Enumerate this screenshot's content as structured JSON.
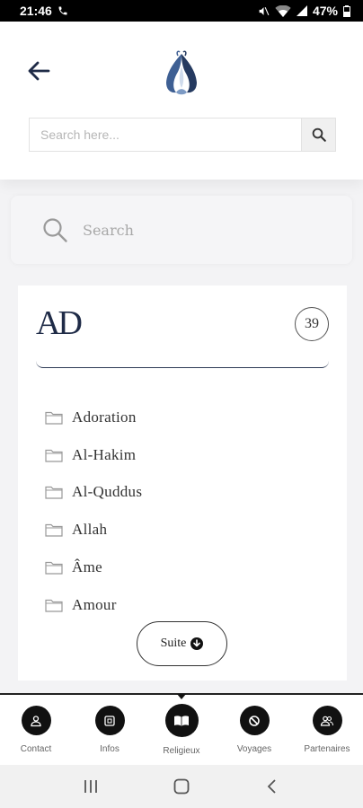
{
  "status_bar": {
    "time": "21:46",
    "battery": "47%"
  },
  "header": {
    "search_placeholder": "Search here..."
  },
  "secondary_search": {
    "label": "Search"
  },
  "card": {
    "logo_text": "AD",
    "count": "39",
    "items": [
      {
        "label": "Adoration"
      },
      {
        "label": "Al-Hakim"
      },
      {
        "label": "Al-Quddus"
      },
      {
        "label": "Allah"
      },
      {
        "label": "Âme"
      },
      {
        "label": "Amour"
      }
    ],
    "more_label": "Suite"
  },
  "bottom_nav": {
    "items": [
      {
        "label": "Contact",
        "icon": "person-icon"
      },
      {
        "label": "Infos",
        "icon": "info-icon"
      },
      {
        "label": "Religieux",
        "icon": "book-icon",
        "active": true
      },
      {
        "label": "Voyages",
        "icon": "prohibited-icon"
      },
      {
        "label": "Partenaires",
        "icon": "people-icon"
      }
    ]
  },
  "colors": {
    "brand_navy": "#1f2b47",
    "logo_blue": "#4a6fa5"
  }
}
